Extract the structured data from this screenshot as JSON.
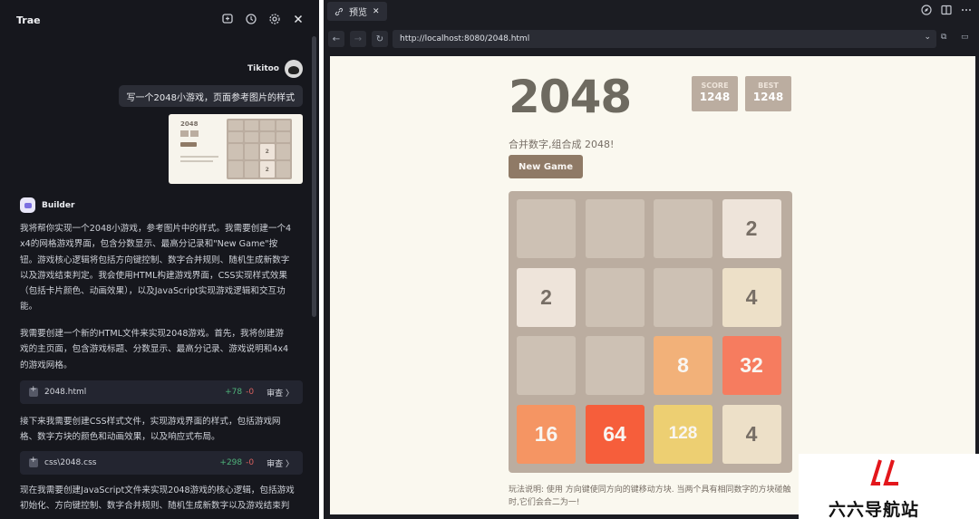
{
  "chat": {
    "title": "Trae",
    "header_icons": [
      "new-chat-icon",
      "history-icon",
      "settings-icon",
      "close-icon"
    ],
    "user": {
      "name": "Tikitoo",
      "message": "写一个2048小游戏，页面参考图片的样式"
    },
    "builder": {
      "name": "Builder",
      "paragraphs": [
        "我将帮你实现一个2048小游戏，参考图片中的样式。我需要创建一个4\nx4的网格游戏界面，包含分数显示、最高分记录和\"New Game\"按\n钮。游戏核心逻辑将包括方向键控制、数字合并规则、随机生成新数字\n以及游戏结束判定。我会使用HTML构建游戏界面，CSS实现样式效果\n（包括卡片颜色、动画效果），以及JavaScript实现游戏逻辑和交互功\n能。",
        "我需要创建一个新的HTML文件来实现2048游戏。首先，我将创建游\n戏的主页面，包含游戏标题、分数显示、最高分记录、游戏说明和4x4\n的游戏网格。",
        "接下来我需要创建CSS样式文件，实现游戏界面的样式，包括游戏网\n格、数字方块的颜色和动画效果，以及响应式布局。",
        "现在我需要创建JavaScript文件来实现2048游戏的核心逻辑，包括游戏\n初始化、方向键控制、数字合并规则、随机生成新数字以及游戏结束判"
      ],
      "files": [
        {
          "name": "2048.html",
          "added": "+78",
          "removed": "-0",
          "action": "审查 〉"
        },
        {
          "name": "css\\2048.css",
          "added": "+298",
          "removed": "-0",
          "action": "审查 〉"
        }
      ]
    },
    "thumbnail_numbers": [
      "2",
      "2"
    ]
  },
  "preview": {
    "tab_label": "预览",
    "tab_close": "✕",
    "url": "http://localhost:8080/2048.html",
    "nav_icons": [
      "back-icon",
      "forward-icon",
      "reload-icon"
    ],
    "toolbar_icons": [
      "compass-icon",
      "split-view-icon",
      "more-icon"
    ]
  },
  "game": {
    "title": "2048",
    "score_label": "SCORE",
    "score": "1248",
    "best_label": "BEST",
    "best": "1248",
    "tagline": "合并数字,组合成 2048!",
    "new_game_label": "New Game",
    "grid": [
      [
        "",
        "",
        "",
        "2"
      ],
      [
        "2",
        "",
        "",
        "4"
      ],
      [
        "",
        "",
        "8",
        "32"
      ],
      [
        "16",
        "64",
        "128",
        "4"
      ]
    ],
    "instructions": "玩法说明: 使用 方向键使同方向的键移动方块. 当两个具有相同数字的方块碰触时,它们会合二为一!",
    "tile_colors": {
      "2": "#eee4da",
      "4": "#ede0c8",
      "8": "#f2b179",
      "16": "#f59563",
      "32": "#f67c5f",
      "64": "#f65e3b",
      "128": "#edcf72"
    }
  },
  "watermark": {
    "text": "六六导航站"
  }
}
